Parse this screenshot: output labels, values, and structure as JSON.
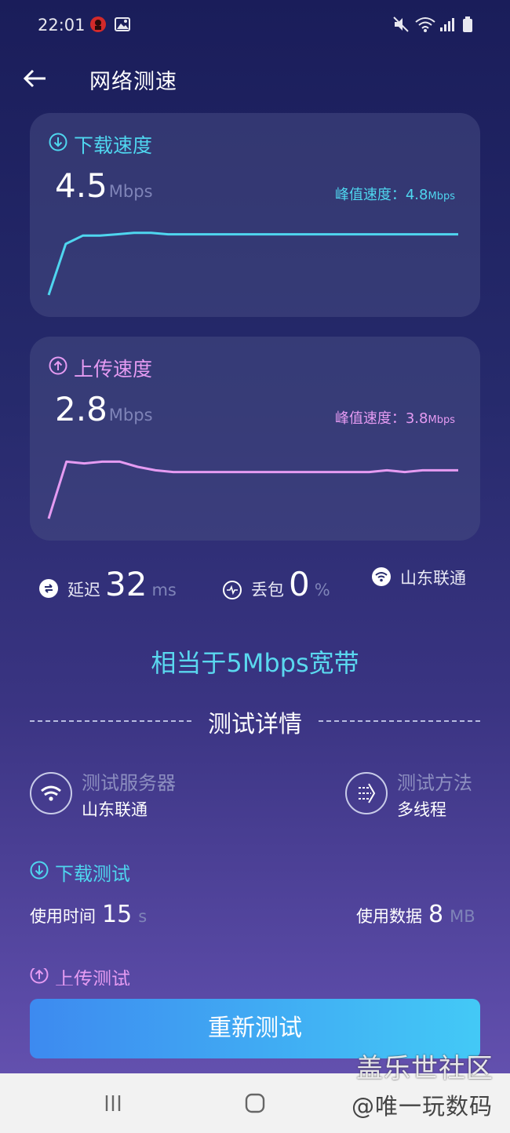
{
  "status": {
    "time": "22:01"
  },
  "header": {
    "title": "网络测速"
  },
  "download": {
    "title": "下载速度",
    "value": "4.5",
    "unit": "Mbps",
    "peak_label": "峰值速度：4.8",
    "peak_unit": "Mbps",
    "color": "#4fd6ef",
    "samples": [
      0.0,
      3.7,
      4.3,
      4.3,
      4.4,
      4.5,
      4.5,
      4.4,
      4.4,
      4.4,
      4.4,
      4.4,
      4.4,
      4.4,
      4.4,
      4.4,
      4.4,
      4.4,
      4.4,
      4.4,
      4.4,
      4.4,
      4.4,
      4.4,
      4.4
    ]
  },
  "upload": {
    "title": "上传速度",
    "value": "2.8",
    "unit": "Mbps",
    "peak_label": "峰值速度：3.8",
    "peak_unit": "Mbps",
    "color": "#e59bf2",
    "samples": [
      0.0,
      3.3,
      3.2,
      3.3,
      3.3,
      3.0,
      2.8,
      2.7,
      2.7,
      2.7,
      2.7,
      2.7,
      2.7,
      2.7,
      2.7,
      2.7,
      2.7,
      2.7,
      2.7,
      2.8,
      2.7,
      2.8,
      2.8,
      2.8
    ]
  },
  "stats": {
    "latency_label": "延迟",
    "latency_value": "32",
    "latency_unit": "ms",
    "loss_label": "丢包",
    "loss_value": "0",
    "loss_unit": "%",
    "isp": "山东联通"
  },
  "equivalent": "相当于5Mbps宽带",
  "details": {
    "section_title": "测试详情",
    "server_label": "测试服务器",
    "server_value": "山东联通",
    "method_label": "测试方法",
    "method_value": "多线程",
    "download_test_title": "下载测试",
    "time_label": "使用时间",
    "time_value": "15",
    "time_unit": "s",
    "data_label": "使用数据",
    "data_value": "8",
    "data_unit": "MB",
    "upload_test_title": "上传测试"
  },
  "retest_button": "重新测试",
  "watermark": {
    "line1": "盖乐世社区",
    "line2": "@唯一玩数码"
  }
}
